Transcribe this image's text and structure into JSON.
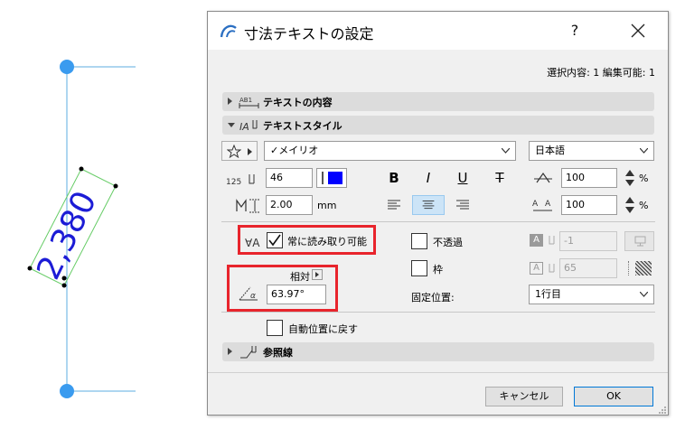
{
  "drawing": {
    "dimension_text": "2,380",
    "colors": {
      "line": "#5dade2",
      "dot": "#3a9bef",
      "text": "#1c1cd6",
      "frame": "#55cc55"
    }
  },
  "dialog": {
    "title": "寸法テキストの設定",
    "help": "?",
    "selection_info": "選択内容: 1 編集可能: 1",
    "sections": {
      "text_content": "テキストの内容",
      "text_style": "テキストスタイル",
      "leader": "参照線"
    },
    "font_name": "✓メイリオ",
    "language": "日本語",
    "font_size": "46",
    "pen_color": "#0000ff",
    "height_value": "2.00",
    "height_unit": "mm",
    "width_percent": "100",
    "spacing_percent": "100",
    "percent_sign": "%",
    "format": {
      "bold": "B",
      "italic": "I",
      "underline": "U",
      "strike": "T"
    },
    "always_readable": "常に読み取り可能",
    "opaque": "不透過",
    "frame": "枠",
    "relative": "相対",
    "angle": "63.97°",
    "anchor_label": "固定位置:",
    "anchor_value": "1行目",
    "bg_pen": "-1",
    "frame_pen": "65",
    "auto_reset": "自動位置に戻す",
    "cancel": "キャンセル",
    "ok": "OK"
  }
}
